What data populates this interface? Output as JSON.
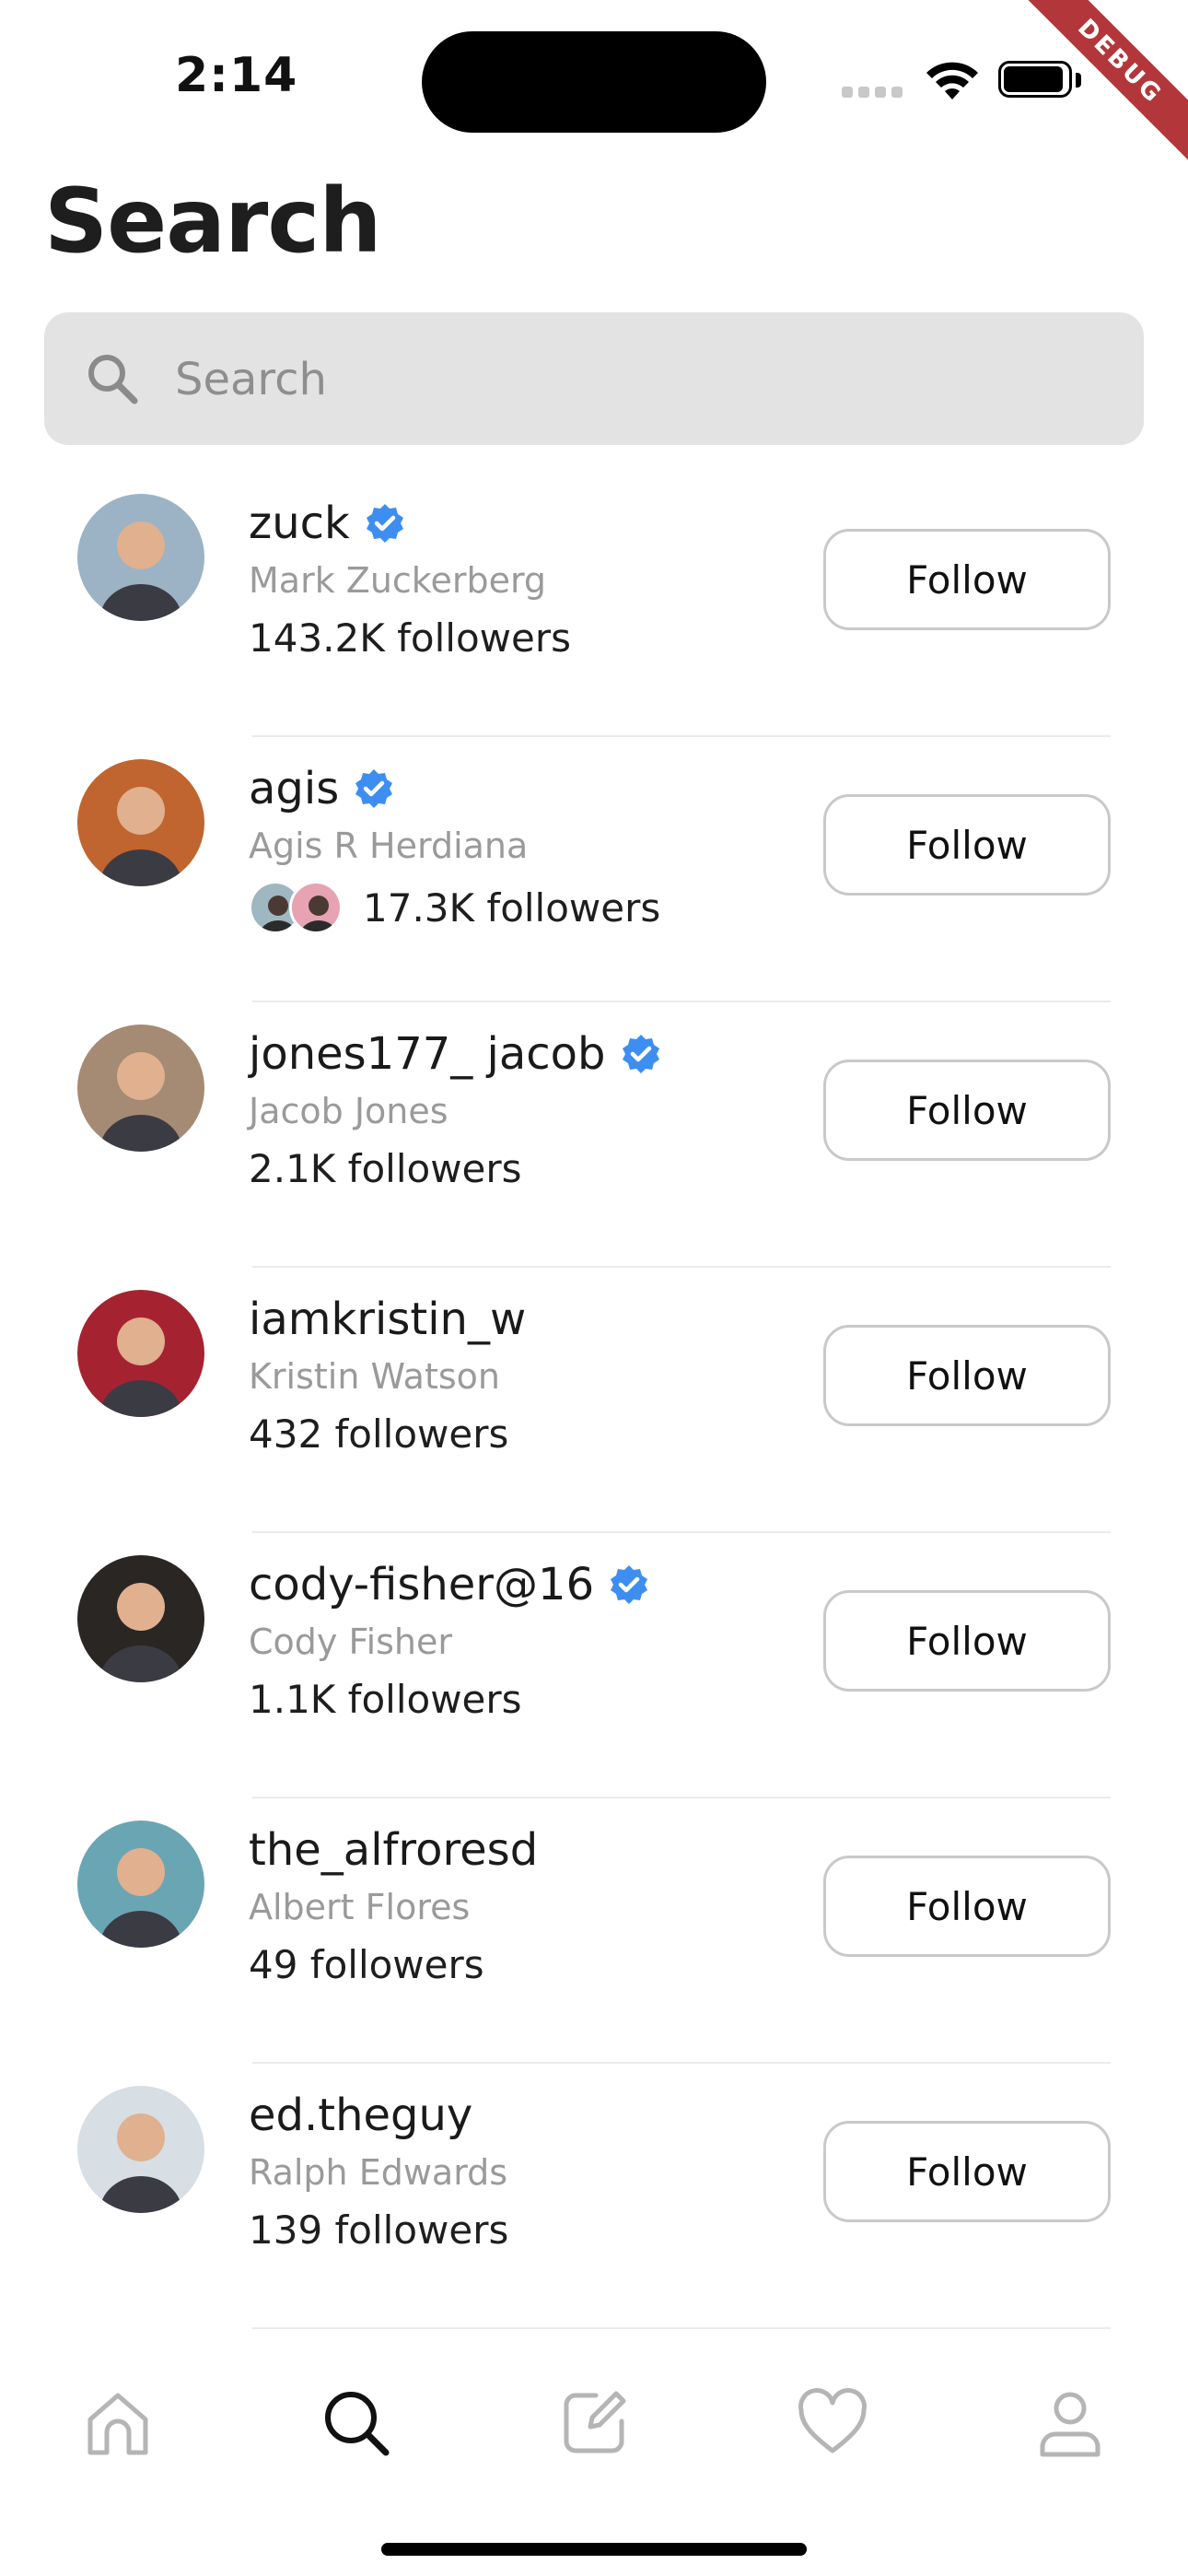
{
  "status_bar": {
    "time": "2:14",
    "debug_label": "DEBUG"
  },
  "page": {
    "title": "Search"
  },
  "search": {
    "placeholder": "Search",
    "value": ""
  },
  "follow_label": "Follow",
  "users": [
    {
      "username": "zuck",
      "name": "Mark Zuckerberg",
      "followers": "143.2K followers",
      "verified": true,
      "avatar_bg": "#9bb3c4"
    },
    {
      "username": "agis",
      "name": "Agis R Herdiana",
      "followers": "17.3K followers",
      "verified": true,
      "avatar_bg": "#c0652f",
      "mutual_avatars": 2
    },
    {
      "username": "jones177_ jacob",
      "name": "Jacob Jones",
      "followers": "2.1K followers",
      "verified": true,
      "avatar_bg": "#a58a74"
    },
    {
      "username": "iamkristin_w",
      "name": "Kristin Watson",
      "followers": "432 followers",
      "verified": false,
      "avatar_bg": "#a52331"
    },
    {
      "username": "cody-fisher@16",
      "name": "Cody Fisher",
      "followers": "1.1K followers",
      "verified": true,
      "avatar_bg": "#2a2624"
    },
    {
      "username": "the_alfroresd",
      "name": "Albert Flores",
      "followers": "49 followers",
      "verified": false,
      "avatar_bg": "#6aa5b4"
    },
    {
      "username": "ed.theguy",
      "name": "Ralph Edwards",
      "followers": "139 followers",
      "verified": false,
      "avatar_bg": "#d7dee4"
    }
  ],
  "nav": [
    {
      "icon": "home-icon",
      "active": false
    },
    {
      "icon": "search-icon",
      "active": true
    },
    {
      "icon": "compose-icon",
      "active": false
    },
    {
      "icon": "heart-icon",
      "active": false
    },
    {
      "icon": "profile-icon",
      "active": false
    }
  ],
  "colors": {
    "verified": "#3d8ef0",
    "nav_inactive": "#b5b5b5",
    "nav_active": "#111111"
  }
}
